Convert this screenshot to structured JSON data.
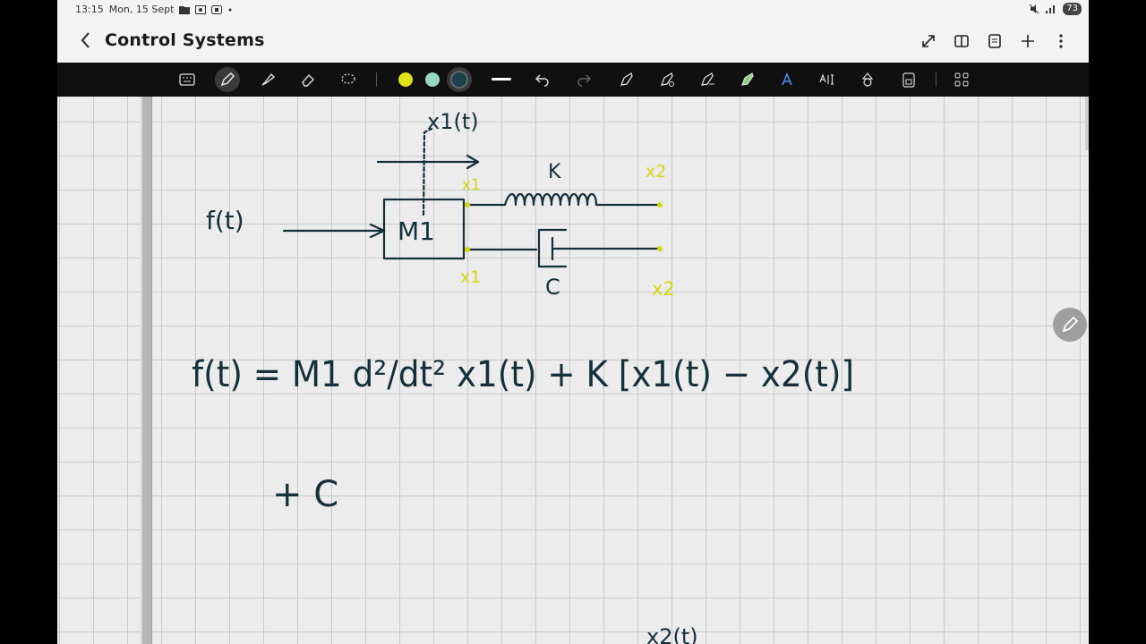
{
  "status_bar": {
    "time": "13:15",
    "date": "Mon, 15 Sept",
    "battery": "73",
    "icons": [
      "folder-icon",
      "screen-record-icon",
      "screenshot-icon",
      "dot-icon",
      "mute-icon",
      "signal-icon"
    ]
  },
  "header": {
    "title": "Control Systems",
    "back_icon": "chevron-left-icon",
    "actions": [
      "expand-icon",
      "book-view-icon",
      "page-settings-icon",
      "add-icon",
      "more-vertical-icon"
    ]
  },
  "toolbar": {
    "tools": [
      "keyboard-icon",
      "pen-icon",
      "highlighter-icon",
      "eraser-icon",
      "lasso-icon",
      "color-yellow",
      "color-teal",
      "color-navy",
      "stroke-width-icon",
      "undo-icon",
      "redo-icon",
      "shape-icon",
      "pen-settings-icon",
      "text-pen-icon",
      "highlight-pen-icon",
      "text-icon",
      "text-recognition-icon",
      "shapes-icon",
      "lock-icon",
      "grid-menu-icon"
    ],
    "active_tool": "pen-icon",
    "colors": {
      "yellow": "#e0e016",
      "teal": "#9ad8c6",
      "navy": "#1e3f4f"
    }
  },
  "colors": {
    "ink": "#14303b",
    "highlight": "#d6d610",
    "toolbar_bg": "#101010",
    "canvas_bg": "#ececec",
    "grid": "#c9c9c9"
  },
  "note": {
    "diagram": {
      "force_label": "f(t)",
      "mass_label": "M1",
      "displacement_label": "x1(t)",
      "spring_label": "K",
      "damper_label": "C",
      "node_labels": [
        "x1",
        "x2",
        "x1",
        "x2"
      ]
    },
    "equation_line1": "f(t) = M1 d²/dt² x1(t) + K [x1(t) − x2(t)]",
    "equation_line2": "+ C",
    "partial_bottom": "x2(t)"
  }
}
